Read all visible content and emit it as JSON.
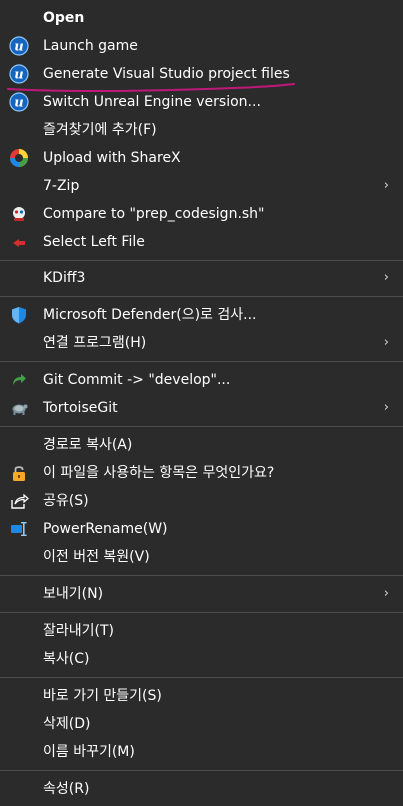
{
  "colors": {
    "background": "#2b2b2b",
    "separator": "#4d4d4d",
    "annotation": "#c0187a",
    "unreal_blue": "#1565c0"
  },
  "menu": {
    "items": [
      {
        "label": "Open",
        "icon": "none"
      },
      {
        "label": "Launch game",
        "icon": "unreal-icon"
      },
      {
        "label": "Generate Visual Studio project files",
        "icon": "unreal-icon"
      },
      {
        "label": "Switch Unreal Engine version...",
        "icon": "unreal-icon"
      },
      {
        "label": "즐겨찾기에 추가(F)",
        "icon": "none"
      },
      {
        "label": "Upload with ShareX",
        "icon": "sharex-icon"
      },
      {
        "label": "7-Zip",
        "icon": "none",
        "submenu": true
      },
      {
        "label": "Compare to \"prep_codesign.sh\"",
        "icon": "kdiff-compare-icon"
      },
      {
        "label": "Select Left File",
        "icon": "kdiff-select-icon"
      },
      {
        "label": "KDiff3",
        "icon": "none",
        "submenu": true
      },
      {
        "label": "Microsoft Defender(으)로 검사...",
        "icon": "defender-shield-icon"
      },
      {
        "label": "연결 프로그램(H)",
        "icon": "none",
        "submenu": true
      },
      {
        "label": "Git Commit -> \"develop\"...",
        "icon": "git-commit-icon"
      },
      {
        "label": "TortoiseGit",
        "icon": "tortoisegit-icon",
        "submenu": true
      },
      {
        "label": "경로로 복사(A)",
        "icon": "none"
      },
      {
        "label": "이 파일을 사용하는 항목은 무엇인가요?",
        "icon": "lock-icon"
      },
      {
        "label": "공유(S)",
        "icon": "share-icon"
      },
      {
        "label": "PowerRename(W)",
        "icon": "powerrename-icon"
      },
      {
        "label": "이전 버전 복원(V)",
        "icon": "none"
      },
      {
        "label": "보내기(N)",
        "icon": "none",
        "submenu": true
      },
      {
        "label": "잘라내기(T)",
        "icon": "none"
      },
      {
        "label": "복사(C)",
        "icon": "none"
      },
      {
        "label": "바로 가기 만들기(S)",
        "icon": "none"
      },
      {
        "label": "삭제(D)",
        "icon": "none"
      },
      {
        "label": "이름 바꾸기(M)",
        "icon": "none"
      },
      {
        "label": "속성(R)",
        "icon": "none"
      }
    ]
  }
}
